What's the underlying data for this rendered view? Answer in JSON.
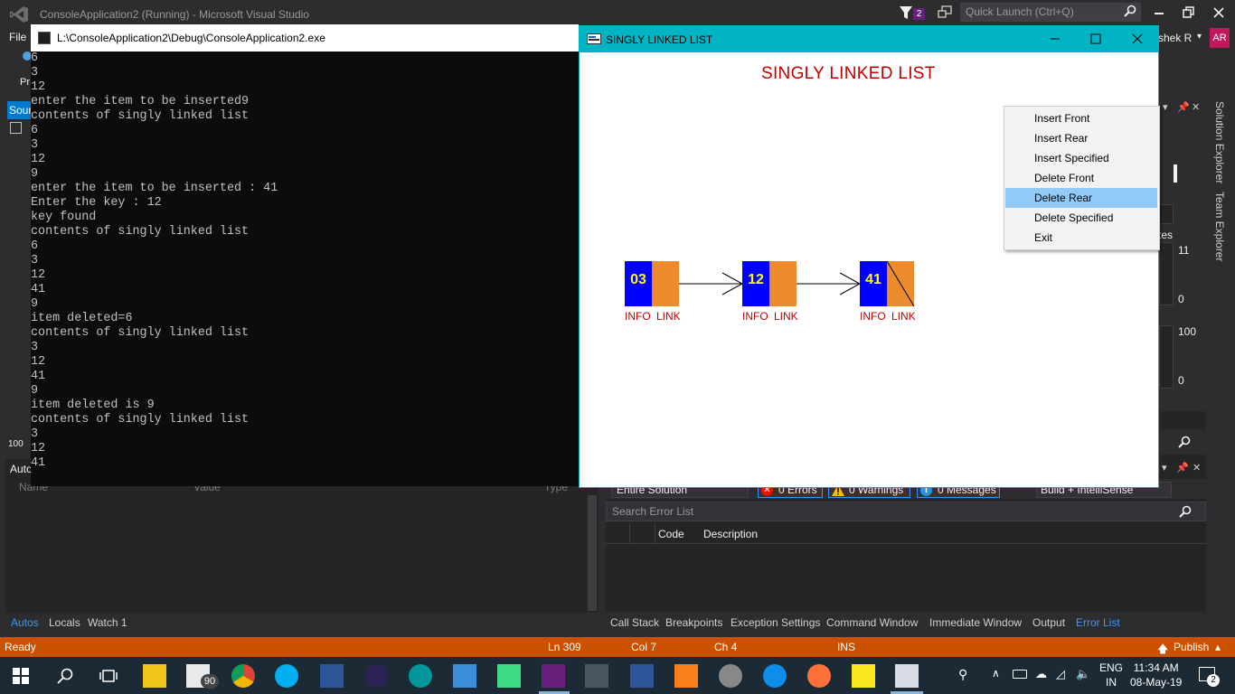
{
  "vs": {
    "title": "ConsoleApplication2 (Running) - Microsoft Visual Studio",
    "notification_count": "2",
    "quick_launch_placeholder": "Quick Launch (Ctrl+Q)",
    "menu_file": "File",
    "user_name": "shek R",
    "user_initials": "AR",
    "left_labels": [
      "Pr",
      "Sour",
      "100"
    ],
    "side_tabs": [
      "Solution Explorer",
      "Team Explorer"
    ],
    "right_values": [
      "tes",
      "11",
      "0",
      "100",
      "0"
    ]
  },
  "autos": {
    "title": "Auto",
    "columns": [
      "Name",
      "Value",
      "Type"
    ],
    "tabs": [
      "Autos",
      "Locals",
      "Watch 1"
    ]
  },
  "error_list": {
    "scope": "Entire Solution",
    "errors": "0 Errors",
    "warnings": "0 Warnings",
    "messages": "0 Messages",
    "build_filter": "Build + IntelliSense",
    "search_placeholder": "Search Error List",
    "columns": [
      "Code",
      "Description"
    ],
    "bottom_tabs": [
      "Call Stack",
      "Breakpoints",
      "Exception Settings",
      "Command Window",
      "Immediate Window",
      "Output",
      "Error List"
    ]
  },
  "status": {
    "ready": "Ready",
    "line": "Ln 309",
    "col": "Col 7",
    "ch": "Ch 4",
    "mode": "INS",
    "publish": "Publish"
  },
  "console": {
    "title": "L:\\ConsoleApplication2\\Debug\\ConsoleApplication2.exe",
    "text": "6\n3\n12\nenter the item to be inserted9\ncontents of singly linked list\n6\n3\n12\n9\nenter the item to be inserted : 41\nEnter the key : 12\nkey found\ncontents of singly linked list\n6\n3\n12\n41\n9\nitem deleted=6\ncontents of singly linked list\n3\n12\n41\n9\nitem deleted is 9\ncontents of singly linked list\n3\n12\n41"
  },
  "sll": {
    "window_title": "SINGLY LINKED LIST",
    "heading": "SINGLY LINKED LIST",
    "nodes": [
      "03",
      "12",
      "41"
    ],
    "info_label": "INFO",
    "link_label": "LINK",
    "colors": {
      "info": "#0000ff",
      "link": "#ed8b2f",
      "heading": "#c00000",
      "node_text": "#ffff00"
    }
  },
  "context_menu": {
    "items": [
      "Insert Front",
      "Insert Rear",
      "Insert Specified",
      "Delete Front",
      "Delete Rear",
      "Delete Specified",
      "Exit"
    ],
    "highlighted": "Delete Rear"
  },
  "taskbar": {
    "badge": "90",
    "language": "ENG",
    "region": "IN",
    "time": "11:34 AM",
    "date": "08-May-19",
    "notification_count": "2"
  }
}
